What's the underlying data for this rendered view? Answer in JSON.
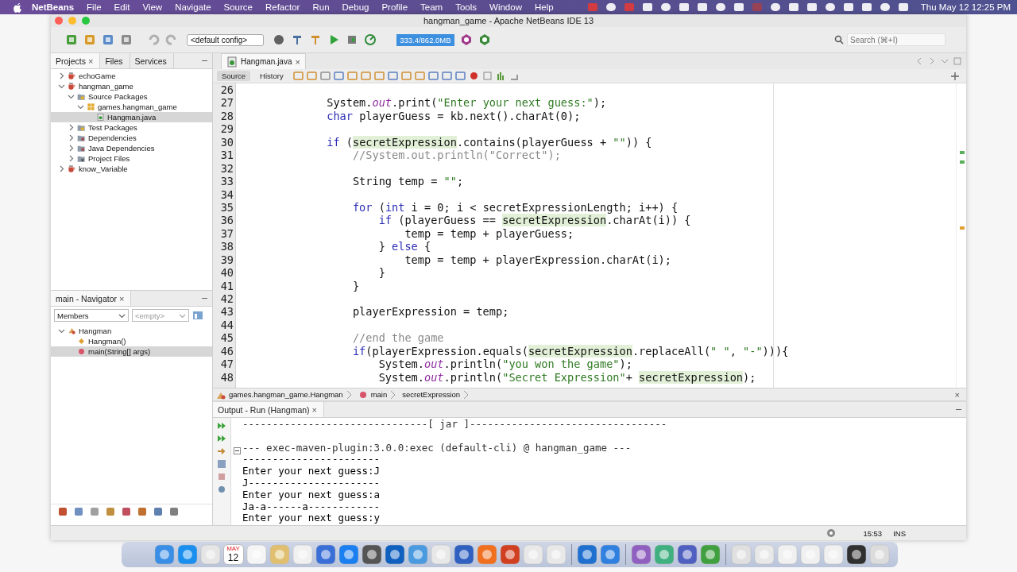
{
  "menubar": {
    "app": "NetBeans",
    "menus": [
      "File",
      "Edit",
      "View",
      "Navigate",
      "Source",
      "Refactor",
      "Run",
      "Debug",
      "Profile",
      "Team",
      "Tools",
      "Window",
      "Help"
    ],
    "clock": "Thu May 12  12:25 PM"
  },
  "window": {
    "title": "hangman_game - Apache NetBeans IDE 13"
  },
  "toolbar": {
    "config": "<default config>",
    "memory": "333.4/862.0MB",
    "search": {
      "placeholder": "Search (⌘+I)"
    }
  },
  "left_tabs": [
    {
      "label": "Projects",
      "selected": true,
      "close": "×"
    },
    {
      "label": "Files",
      "selected": false
    },
    {
      "label": "Services",
      "selected": false
    }
  ],
  "project_tree": [
    {
      "label": "echoGame",
      "kind": "project",
      "expanded": false,
      "selected": false
    },
    {
      "label": "hangman_game",
      "kind": "project",
      "expanded": true,
      "selected": false,
      "children": [
        {
          "label": "Source Packages",
          "kind": "source",
          "expanded": true,
          "selected": false,
          "children": [
            {
              "label": "games.hangman_game",
              "kind": "package",
              "expanded": true,
              "selected": false,
              "children": [
                {
                  "label": "Hangman.java",
                  "kind": "java",
                  "selected": true
                }
              ]
            }
          ]
        },
        {
          "label": "Test Packages",
          "kind": "source",
          "expanded": false,
          "selected": false
        },
        {
          "label": "Dependencies",
          "kind": "library",
          "expanded": false,
          "selected": false
        },
        {
          "label": "Java Dependencies",
          "kind": "library",
          "expanded": false,
          "selected": false
        },
        {
          "label": "Project Files",
          "kind": "files",
          "expanded": false,
          "selected": false
        }
      ]
    },
    {
      "label": "know_Variable",
      "kind": "project",
      "expanded": false,
      "selected": false
    }
  ],
  "navigator": {
    "title": "main - Navigator",
    "close": "×",
    "filter": "Members",
    "secondary": "<empty>",
    "tree": [
      {
        "label": "Hangman",
        "kind": "class",
        "expanded": true,
        "selected": false,
        "children": [
          {
            "label": "Hangman()",
            "kind": "constructor",
            "selected": false
          },
          {
            "label": "main(String[] args)",
            "kind": "method",
            "selected": true
          }
        ]
      }
    ]
  },
  "editor": {
    "tab": "Hangman.java",
    "close": "×",
    "views": [
      {
        "label": "Source",
        "selected": true
      },
      {
        "label": "History",
        "selected": false
      }
    ],
    "lines": [
      {
        "number": "26"
      },
      {
        "number": "27",
        "tokens": [
          {
            "kind": "plain",
            "text": "System."
          },
          {
            "kind": "field",
            "text": "out"
          },
          {
            "kind": "plain",
            "text": ".print("
          },
          {
            "kind": "string",
            "text": "\"Enter your next guess:\""
          },
          {
            "kind": "plain",
            "text": ");"
          }
        ]
      },
      {
        "number": "28",
        "tokens": [
          {
            "kind": "keyword",
            "text": "char"
          },
          {
            "kind": "plain",
            "text": " playerGuess = kb.next().charAt(0);"
          }
        ]
      },
      {
        "number": "29"
      },
      {
        "number": "30",
        "tokens": [
          {
            "kind": "keyword",
            "text": "if"
          },
          {
            "kind": "plain",
            "text": " ("
          },
          {
            "kind": "highlight",
            "text": "secretExpression"
          },
          {
            "kind": "plain",
            "text": ".contains(playerGuess + "
          },
          {
            "kind": "string",
            "text": "\"\""
          },
          {
            "kind": "plain",
            "text": ")) {"
          }
        ],
        "children": [
          {
            "number": "31",
            "tokens": [
              {
                "kind": "comment",
                "text": "//System.out.println(\"Correct\");"
              }
            ]
          },
          {
            "number": "32"
          },
          {
            "number": "33",
            "tokens": [
              {
                "kind": "plain",
                "text": "String temp = "
              },
              {
                "kind": "string",
                "text": "\"\""
              },
              {
                "kind": "plain",
                "text": ";"
              }
            ]
          },
          {
            "number": "34"
          },
          {
            "number": "35",
            "tokens": [
              {
                "kind": "keyword",
                "text": "for"
              },
              {
                "kind": "plain",
                "text": " ("
              },
              {
                "kind": "keyword",
                "text": "int"
              },
              {
                "kind": "plain",
                "text": " i = 0; i < secretExpressionLength; i++) {"
              }
            ],
            "children": [
              {
                "number": "36",
                "tokens": [
                  {
                    "kind": "keyword",
                    "text": "if"
                  },
                  {
                    "kind": "plain",
                    "text": " (playerGuess == "
                  },
                  {
                    "kind": "highlight",
                    "text": "secretExpression"
                  },
                  {
                    "kind": "plain",
                    "text": ".charAt(i)) {"
                  }
                ],
                "children": [
                  {
                    "number": "37",
                    "tokens": [
                      {
                        "kind": "plain",
                        "text": "temp = temp + playerGuess;"
                      }
                    ]
                  }
                ]
              },
              {
                "number": "38",
                "tokens": [
                  {
                    "kind": "plain",
                    "text": "} "
                  },
                  {
                    "kind": "keyword",
                    "text": "else"
                  },
                  {
                    "kind": "plain",
                    "text": " {"
                  }
                ],
                "children": [
                  {
                    "number": "39",
                    "tokens": [
                      {
                        "kind": "plain",
                        "text": "temp = temp + playerExpression.charAt(i);"
                      }
                    ]
                  }
                ]
              },
              {
                "number": "40",
                "tokens": [
                  {
                    "kind": "plain",
                    "text": "}"
                  }
                ]
              }
            ]
          },
          {
            "number": "41",
            "tokens": [
              {
                "kind": "plain",
                "text": "}"
              }
            ]
          },
          {
            "number": "42"
          },
          {
            "number": "43",
            "tokens": [
              {
                "kind": "plain",
                "text": "playerExpression = temp;"
              }
            ]
          },
          {
            "number": "44"
          },
          {
            "number": "45",
            "tokens": [
              {
                "kind": "comment",
                "text": "//end the game"
              }
            ]
          },
          {
            "number": "46",
            "tokens": [
              {
                "kind": "keyword",
                "text": "if"
              },
              {
                "kind": "plain",
                "text": "(playerExpression.equals("
              },
              {
                "kind": "highlight",
                "text": "secretExpression"
              },
              {
                "kind": "plain",
                "text": ".replaceAll("
              },
              {
                "kind": "string",
                "text": "\" \""
              },
              {
                "kind": "plain",
                "text": ", "
              },
              {
                "kind": "string",
                "text": "\"-\""
              },
              {
                "kind": "plain",
                "text": "))){"
              }
            ],
            "children": [
              {
                "number": "47",
                "tokens": [
                  {
                    "kind": "plain",
                    "text": "System."
                  },
                  {
                    "kind": "field",
                    "text": "out"
                  },
                  {
                    "kind": "plain",
                    "text": ".println("
                  },
                  {
                    "kind": "string",
                    "text": "\"you won the game\""
                  },
                  {
                    "kind": "plain",
                    "text": ");"
                  }
                ]
              },
              {
                "number": "48",
                "tokens": [
                  {
                    "kind": "plain",
                    "text": "System."
                  },
                  {
                    "kind": "field",
                    "text": "out"
                  },
                  {
                    "kind": "plain",
                    "text": ".println("
                  },
                  {
                    "kind": "string",
                    "text": "\"Secret Expression\""
                  },
                  {
                    "kind": "plain",
                    "text": "+ "
                  },
                  {
                    "kind": "highlight",
                    "text": "secretExpression"
                  },
                  {
                    "kind": "plain",
                    "text": ");"
                  }
                ]
              }
            ]
          }
        ]
      }
    ],
    "breadcrumbs": [
      {
        "label": "games.hangman_game.Hangman",
        "kind": "class"
      },
      {
        "label": "main",
        "kind": "method"
      },
      {
        "label": "secretExpression",
        "kind": "field"
      }
    ],
    "breadcrumbs_close": "×"
  },
  "output": {
    "title": "Output - Run (Hangman)",
    "close": "×",
    "lines": [
      {
        "text": "-------------------------------[ jar ]---------------------------------",
        "kind": "log"
      },
      {
        "kind": "blank"
      },
      {
        "text": "--- exec-maven-plugin:3.0.0:exec (default-cli) @ hangman_game ---",
        "kind": "log"
      },
      {
        "text": "-----------------------",
        "kind": "io"
      },
      {
        "text": "Enter your next guess:J",
        "kind": "io"
      },
      {
        "text": "J----------------------",
        "kind": "io"
      },
      {
        "text": "Enter your next guess:a",
        "kind": "io"
      },
      {
        "text": "Ja-a------a------------",
        "kind": "io"
      },
      {
        "text": "Enter your next guess:y",
        "kind": "io"
      }
    ]
  },
  "status_bar": {
    "position": "15:53",
    "mode": "INS"
  },
  "dock": {
    "calendar_month": "MAY",
    "calendar_day": "12"
  }
}
